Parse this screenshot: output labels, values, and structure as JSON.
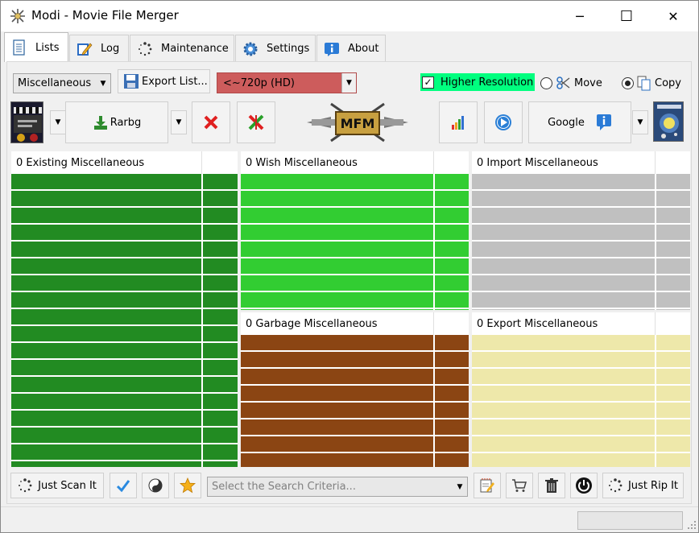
{
  "window": {
    "title": "Modi - Movie File Merger",
    "minimize_glyph": "─",
    "maximize_glyph": "☐",
    "close_glyph": "✕"
  },
  "tabs": [
    {
      "label": "Lists",
      "icon": "document-icon",
      "active": true
    },
    {
      "label": "Log",
      "icon": "pencil-icon",
      "active": false
    },
    {
      "label": "Maintenance",
      "icon": "spinner-icon",
      "active": false
    },
    {
      "label": "Settings",
      "icon": "gear-icon",
      "active": false
    },
    {
      "label": "About",
      "icon": "info-icon",
      "active": false
    }
  ],
  "toolbar1": {
    "category_select": "Miscellaneous",
    "export_label": "Export List...",
    "quality_select": "<~720p (HD)",
    "quality_color": "#cd5c5c",
    "higher_resolution_label": "Higher Resolution",
    "higher_resolution_checked": true,
    "higher_resolution_color": "#00ff7f",
    "move_label": "Move",
    "copy_label": "Copy",
    "selected_mode": "Copy"
  },
  "toolbar2": {
    "rarbg_label": "Rarbg",
    "logo_text": "MFM",
    "google_label": "Google"
  },
  "grids": {
    "existing": {
      "header": "0 Existing Miscellaneous",
      "color": "#228b22"
    },
    "wish": {
      "header": "0 Wish Miscellaneous",
      "color": "#32cd32"
    },
    "import": {
      "header": "0 Import Miscellaneous",
      "color": "#c0c0c0"
    },
    "garbage": {
      "header": "0 Garbage Miscellaneous",
      "color": "#8b4513"
    },
    "export": {
      "header": "0 Export Miscellaneous",
      "color": "#eee8aa"
    }
  },
  "bottom": {
    "scan_label": "Just Scan It",
    "search_placeholder": "Select the Search Criteria...",
    "rip_label": "Just Rip It"
  }
}
